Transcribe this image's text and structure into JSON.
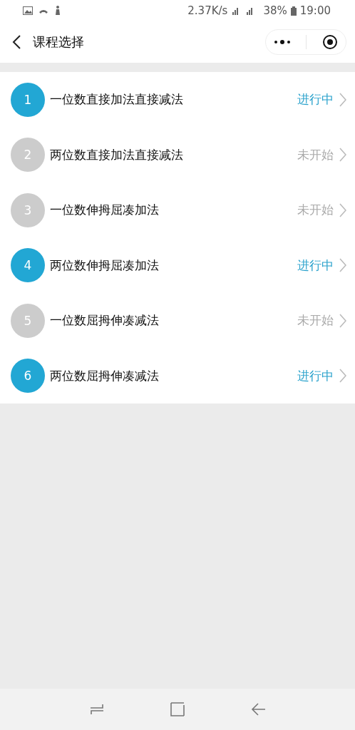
{
  "status_bar": {
    "speed": "2.37K/s",
    "battery": "38%",
    "time": "19:00"
  },
  "header": {
    "title": "课程选择"
  },
  "courses": [
    {
      "number": "1",
      "name": "一位数直接加法直接减法",
      "status": "进行中",
      "kind": "in_progress"
    },
    {
      "number": "2",
      "name": "两位数直接加法直接减法",
      "status": "未开始",
      "kind": "not_started"
    },
    {
      "number": "3",
      "name": "一位数伸拇屈凑加法",
      "status": "未开始",
      "kind": "not_started"
    },
    {
      "number": "4",
      "name": "两位数伸拇屈凑加法",
      "status": "进行中",
      "kind": "in_progress"
    },
    {
      "number": "5",
      "name": "一位数屈拇伸凑减法",
      "status": "未开始",
      "kind": "not_started"
    },
    {
      "number": "6",
      "name": "两位数屈拇伸凑减法",
      "status": "进行中",
      "kind": "in_progress"
    }
  ]
}
